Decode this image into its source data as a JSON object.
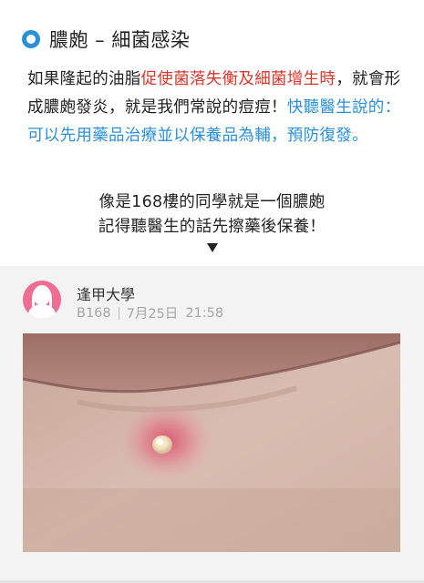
{
  "section": {
    "icon": "circle-bullet-icon",
    "title": "膿皰 – 細菌感染"
  },
  "paragraph": {
    "segments": [
      {
        "text": "如果隆起的油脂",
        "style": "normal"
      },
      {
        "text": "促使菌落失衡及細菌增生時",
        "style": "red"
      },
      {
        "text": "，就會形成膿皰發炎，就是我們常說的痘痘！",
        "style": "normal"
      },
      {
        "text": "快聽醫生說的：可以先用藥品治療並以保養品為輔，預防復發。",
        "style": "blue"
      }
    ]
  },
  "caption": {
    "line1": "像是168樓的同學就是一個膿皰",
    "line2": "記得聽醫生的話先擦藥後保養！",
    "arrow_icon": "down-triangle-icon"
  },
  "post": {
    "avatar_icon": "female-avatar-icon",
    "author": "逢甲大學",
    "floor": "B168",
    "date": "7月25日",
    "time": "21:58",
    "image_alt": "pustule-on-chin-photo"
  },
  "colors": {
    "accent_blue": "#2b8fd6",
    "highlight_red": "#d9362b",
    "avatar_pink": "#ef6d93",
    "card_bg": "#f3f3f3"
  }
}
